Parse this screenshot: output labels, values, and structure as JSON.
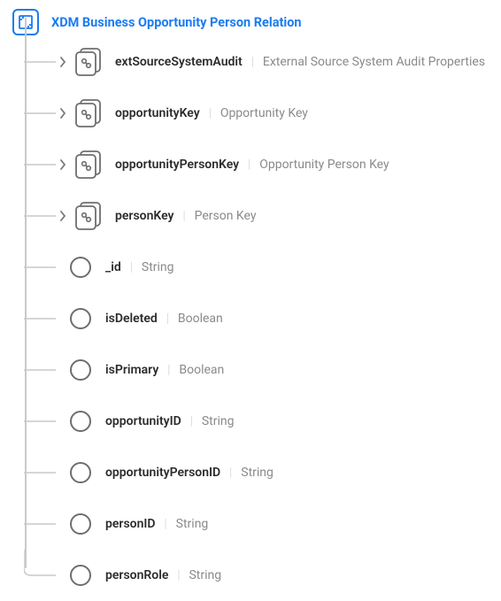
{
  "root": {
    "title": "XDM Business Opportunity Person Relation"
  },
  "fields": [
    {
      "name": "extSourceSystemAudit",
      "type": "External Source System Audit Properties",
      "kind": "object",
      "expandable": true
    },
    {
      "name": "opportunityKey",
      "type": "Opportunity Key",
      "kind": "object",
      "expandable": true
    },
    {
      "name": "opportunityPersonKey",
      "type": "Opportunity Person Key",
      "kind": "object",
      "expandable": true
    },
    {
      "name": "personKey",
      "type": "Person Key",
      "kind": "object",
      "expandable": true
    },
    {
      "name": "_id",
      "type": "String",
      "kind": "leaf",
      "expandable": false
    },
    {
      "name": "isDeleted",
      "type": "Boolean",
      "kind": "leaf",
      "expandable": false
    },
    {
      "name": "isPrimary",
      "type": "Boolean",
      "kind": "leaf",
      "expandable": false
    },
    {
      "name": "opportunityID",
      "type": "String",
      "kind": "leaf",
      "expandable": false
    },
    {
      "name": "opportunityPersonID",
      "type": "String",
      "kind": "leaf",
      "expandable": false
    },
    {
      "name": "personID",
      "type": "String",
      "kind": "leaf",
      "expandable": false
    },
    {
      "name": "personRole",
      "type": "String",
      "kind": "leaf",
      "expandable": false
    }
  ],
  "icons": {
    "chevron": "›"
  }
}
